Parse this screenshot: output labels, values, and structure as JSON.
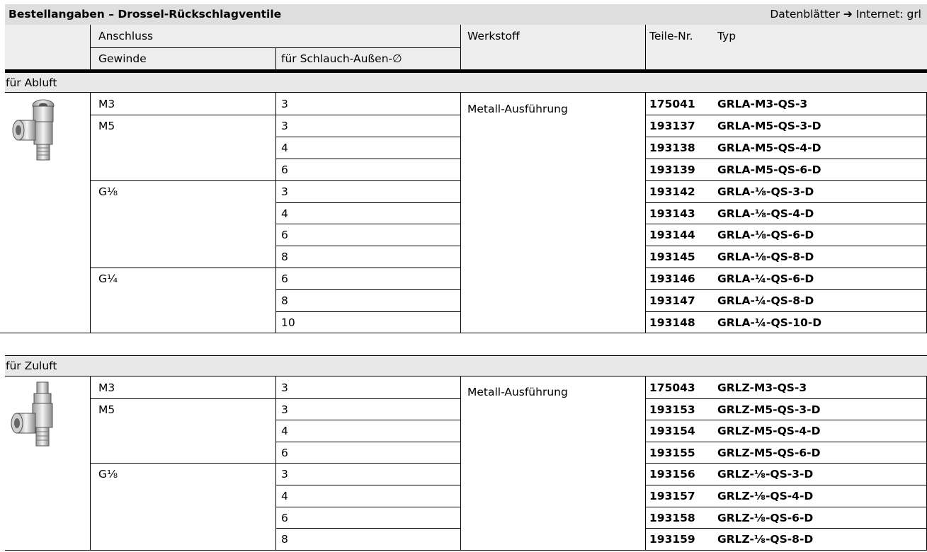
{
  "title": "Bestellangaben – Drossel-Rückschlagventile",
  "reference": "Datenblätter ➔ Internet: grl",
  "columns": {
    "anschluss": "Anschluss",
    "gewinde": "Gewinde",
    "schlauch": "für Schlauch-Außen-∅",
    "werkstoff": "Werkstoff",
    "teilenr": "Teile-Nr.",
    "typ": "Typ"
  },
  "sections": [
    {
      "title": "für Abluft",
      "icon": "exhaust-valve-icon",
      "werkstoff": "Metall-Ausführung",
      "rows": [
        {
          "gewinde": "M3",
          "schlauch": "3",
          "nr": "175041",
          "typ": "GRLA-M3-QS-3"
        },
        {
          "gewinde": "M5",
          "schlauch": "3",
          "nr": "193137",
          "typ": "GRLA-M5-QS-3-D"
        },
        {
          "gewinde": "",
          "schlauch": "4",
          "nr": "193138",
          "typ": "GRLA-M5-QS-4-D"
        },
        {
          "gewinde": "",
          "schlauch": "6",
          "nr": "193139",
          "typ": "GRLA-M5-QS-6-D"
        },
        {
          "gewinde": "G⅛",
          "schlauch": "3",
          "nr": "193142",
          "typ": "GRLA-⅛-QS-3-D"
        },
        {
          "gewinde": "",
          "schlauch": "4",
          "nr": "193143",
          "typ": "GRLA-⅛-QS-4-D"
        },
        {
          "gewinde": "",
          "schlauch": "6",
          "nr": "193144",
          "typ": "GRLA-⅛-QS-6-D"
        },
        {
          "gewinde": "",
          "schlauch": "8",
          "nr": "193145",
          "typ": "GRLA-⅛-QS-8-D"
        },
        {
          "gewinde": "G¼",
          "schlauch": "6",
          "nr": "193146",
          "typ": "GRLA-¼-QS-6-D"
        },
        {
          "gewinde": "",
          "schlauch": "8",
          "nr": "193147",
          "typ": "GRLA-¼-QS-8-D"
        },
        {
          "gewinde": "",
          "schlauch": "10",
          "nr": "193148",
          "typ": "GRLA-¼-QS-10-D"
        }
      ]
    },
    {
      "title": "für Zuluft",
      "icon": "supply-valve-icon",
      "werkstoff": "Metall-Ausführung",
      "rows": [
        {
          "gewinde": "M3",
          "schlauch": "3",
          "nr": "175043",
          "typ": "GRLZ-M3-QS-3"
        },
        {
          "gewinde": "M5",
          "schlauch": "3",
          "nr": "193153",
          "typ": "GRLZ-M5-QS-3-D"
        },
        {
          "gewinde": "",
          "schlauch": "4",
          "nr": "193154",
          "typ": "GRLZ-M5-QS-4-D"
        },
        {
          "gewinde": "",
          "schlauch": "6",
          "nr": "193155",
          "typ": "GRLZ-M5-QS-6-D"
        },
        {
          "gewinde": "G⅛",
          "schlauch": "3",
          "nr": "193156",
          "typ": "GRLZ-⅛-QS-3-D"
        },
        {
          "gewinde": "",
          "schlauch": "4",
          "nr": "193157",
          "typ": "GRLZ-⅛-QS-4-D"
        },
        {
          "gewinde": "",
          "schlauch": "6",
          "nr": "193158",
          "typ": "GRLZ-⅛-QS-6-D"
        },
        {
          "gewinde": "",
          "schlauch": "8",
          "nr": "193159",
          "typ": "GRLZ-⅛-QS-8-D"
        }
      ]
    }
  ]
}
